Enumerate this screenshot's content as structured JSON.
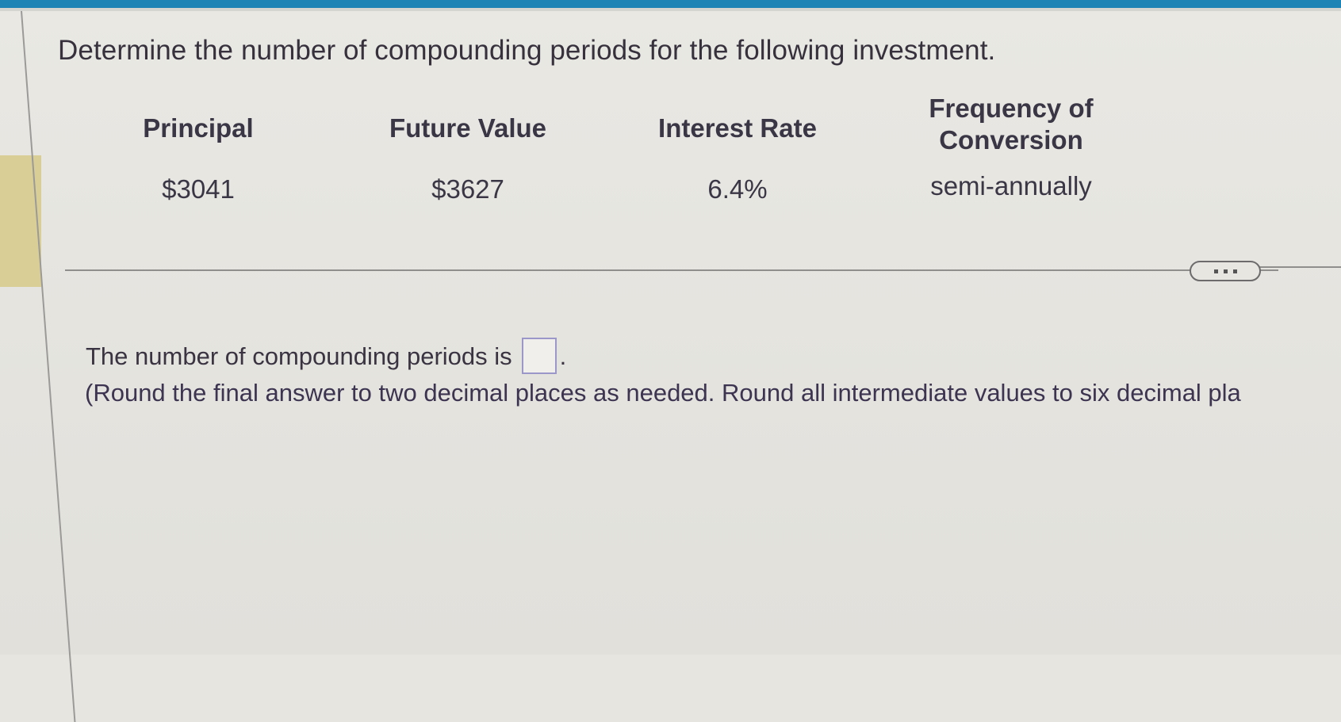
{
  "question": {
    "prompt": "Determine the number of compounding periods for the following investment."
  },
  "table": {
    "headers": {
      "principal": "Principal",
      "future_value": "Future Value",
      "interest_rate": "Interest Rate",
      "frequency_line1": "Frequency of",
      "frequency_line2": "Conversion"
    },
    "row": {
      "principal": "$3041",
      "future_value": "$3627",
      "interest_rate": "6.4%",
      "frequency": "semi-annually"
    }
  },
  "more_button": {
    "icon": "ellipsis-icon"
  },
  "answer": {
    "text": "The number of compounding periods is",
    "input_value": "",
    "period": ".",
    "note": "(Round the final answer to two decimal places as needed. Round all intermediate values to six decimal pla"
  },
  "colors": {
    "top_bar": "#1d84b5",
    "side_tab": "#d9ce96",
    "input_border": "#9b97c8"
  }
}
